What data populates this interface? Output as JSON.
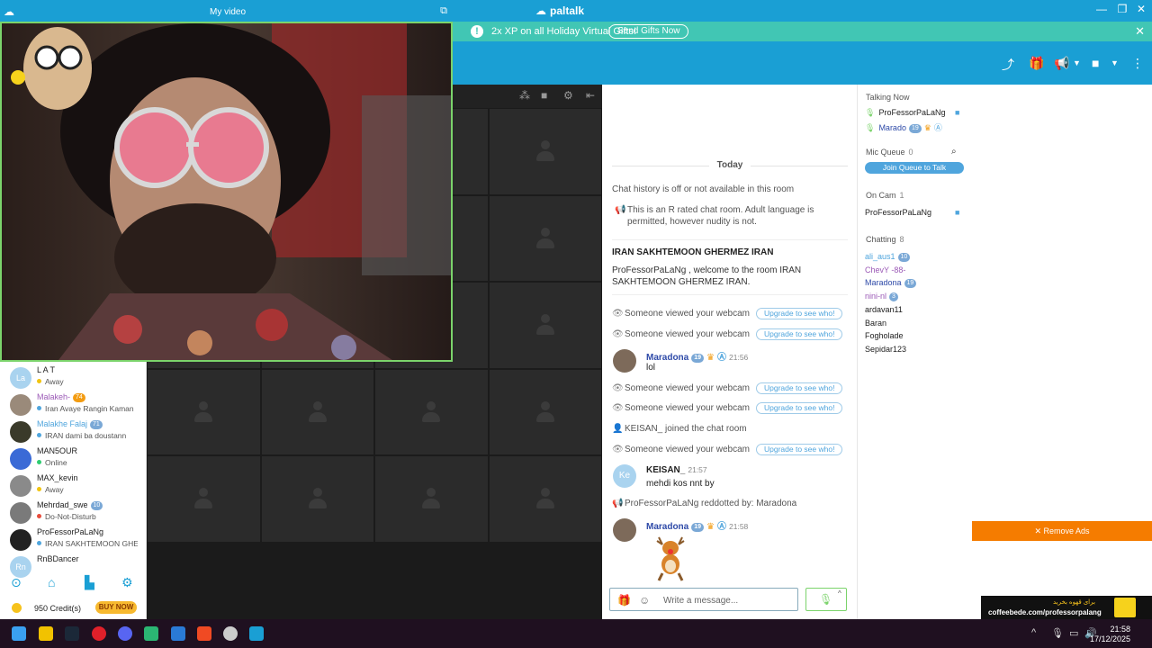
{
  "app": {
    "brand": "paltalk",
    "window_controls": [
      "—",
      "❐",
      "✕"
    ]
  },
  "promo": {
    "message": "2x XP on all Holiday Virtual Gifts!",
    "button": "Send Gifts Now"
  },
  "my_video": {
    "title": "My video"
  },
  "room_list": {
    "users": [
      {
        "name": "L A T",
        "initials": "La",
        "status": "Away",
        "status_color": "#f1c40f",
        "badge": ""
      },
      {
        "name": "Malakeh-",
        "initials": "",
        "status": "Iran Avaye Rangin Kaman",
        "status_color": "#4fa5dd",
        "badge": "74",
        "name_color": "#9b59b6"
      },
      {
        "name": "Malakhe Falaj",
        "initials": "",
        "status": "IRAN dami ba doustann",
        "status_color": "#4fa5dd",
        "badge": "71",
        "name_color": "#4fa5dd"
      },
      {
        "name": "MAN5OUR",
        "initials": "",
        "status": "Online",
        "status_color": "#2ecc71",
        "badge": ""
      },
      {
        "name": "MAX_kevin",
        "initials": "",
        "status": "Away",
        "status_color": "#f1c40f",
        "badge": ""
      },
      {
        "name": "Mehrdad_swe",
        "initials": "",
        "status": "Do-Not-Disturb",
        "status_color": "#e74c3c",
        "badge": "10"
      },
      {
        "name": "ProFessorPaLaNg",
        "initials": "",
        "status": "IRAN SAKHTEMOON GHE",
        "status_color": "#4fa5dd",
        "badge": ""
      },
      {
        "name": "RnBDancer",
        "initials": "Rn",
        "status": "",
        "status_color": "#4fa5dd",
        "badge": ""
      }
    ],
    "credits": "950 Credit(s)",
    "buy_now": "BUY NOW"
  },
  "chat": {
    "date_divider": "Today",
    "history_notice": "Chat history is off or not available in this room",
    "rating_notice": "This is an R rated chat room. Adult language is permitted, however nudity is not.",
    "room_name": "IRAN SAKHTEMOON GHERMEZ IRAN",
    "welcome": "ProFessorPaLaNg , welcome to the room  IRAN SAKHTEMOON GHERMEZ IRAN.",
    "webcam_notice": "Someone viewed your webcam",
    "upgrade_label": "Upgrade to see who!",
    "messages": [
      {
        "name": "Maradona",
        "badge": "19",
        "time": "21:56",
        "text": "lol",
        "name_color": "#2e4aa8"
      },
      {
        "name": "KEISAN_",
        "badge": "",
        "time": "21:57",
        "text": "mehdi kos nnt by",
        "name_color": "#222"
      },
      {
        "name": "Maradona",
        "badge": "19",
        "time": "21:58",
        "text": "",
        "name_color": "#2e4aa8"
      }
    ],
    "join_notice": "KEISAN_ joined the chat room",
    "reddot_notice": "ProFessorPaLaNg reddotted by: Maradona",
    "keisan_initials": "Ke",
    "composer_placeholder": "Write a message..."
  },
  "sidebar": {
    "talking_now": "Talking Now",
    "talkers": [
      "ProFessorPaLaNg",
      "Marado"
    ],
    "talker_badge": "19",
    "mic_queue": "Mic Queue",
    "mic_queue_count": "0",
    "join_queue": "Join Queue to Talk",
    "on_cam": "On Cam",
    "on_cam_count": "1",
    "on_cam_users": [
      "ProFessorPaLaNg"
    ],
    "chatting": "Chatting",
    "chatting_count": "8",
    "chatting_users": [
      {
        "name": "ali_aus1",
        "badge": "10",
        "color": "#4fa5dd"
      },
      {
        "name": "ChevY -88-",
        "badge": "",
        "color": "#9b59b6"
      },
      {
        "name": "Maradona",
        "badge": "19",
        "color": "#2e4aa8"
      },
      {
        "name": "nini-nl",
        "badge": "3",
        "color": "#9b59b6"
      },
      {
        "name": "ardavan11",
        "badge": "",
        "color": "#222"
      },
      {
        "name": "Baran",
        "badge": "",
        "color": "#222"
      },
      {
        "name": "Fogholade",
        "badge": "",
        "color": "#222"
      },
      {
        "name": "Sepidar123",
        "badge": "",
        "color": "#222"
      }
    ]
  },
  "ads": {
    "remove_ads": "✕ Remove Ads",
    "banner_url": "coffeebede.com/professorpalang",
    "banner_tagline": "برای قهوه بخرید"
  },
  "taskbar": {
    "time": "21:58",
    "date": "17/12/2025"
  },
  "colors": {
    "brand_blue": "#1a9fd4",
    "promo_teal": "#41c6b4",
    "remove_ads_orange": "#f57c00",
    "video_border_green": "#7bd36b"
  }
}
